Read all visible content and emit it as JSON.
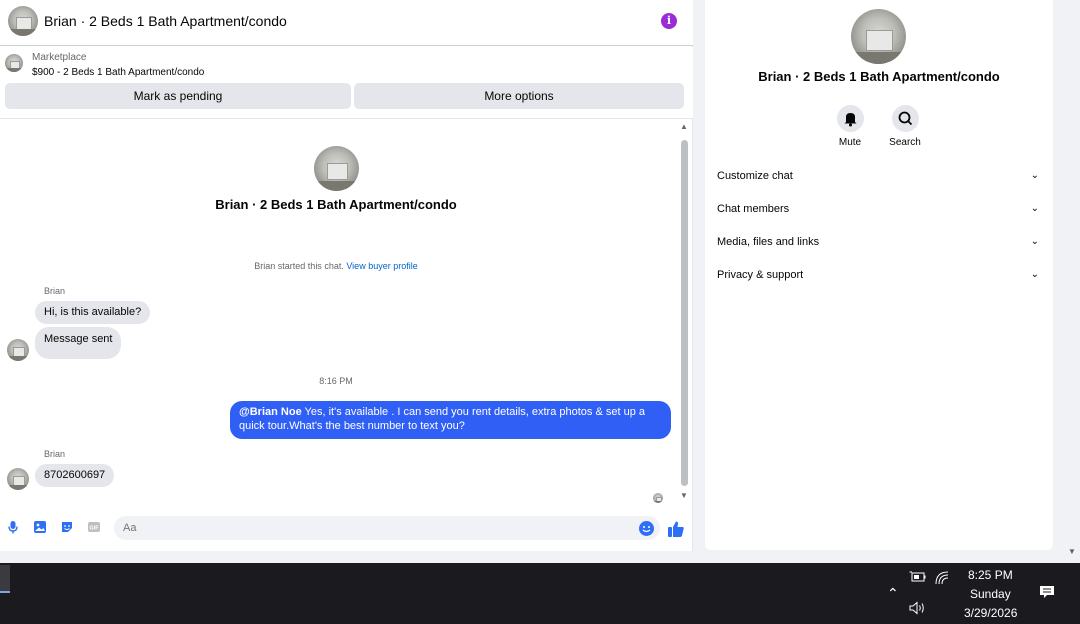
{
  "header": {
    "title": "Brian · 2 Beds 1 Bath Apartment/condo"
  },
  "marketplace": {
    "label": "Marketplace",
    "listing": "$900 - 2 Beds 1 Bath Apartment/condo",
    "pending_button": "Mark as pending",
    "more_button": "More options"
  },
  "conversation": {
    "title": "Brian · 2 Beds 1 Bath Apartment/condo",
    "started_text": "Brian started this chat.",
    "buyer_profile_link": "View buyer profile",
    "messages": [
      {
        "sender": "Brian",
        "text": "Hi, is this available?"
      },
      {
        "text": "Message sent"
      },
      {
        "time": "8:16 PM"
      },
      {
        "mention": "@Brian Noe",
        "text": " Yes, it's available .  I can send you rent details, extra photos & set up a quick tour.What's the best number to text you?"
      },
      {
        "sender": "Brian",
        "text": "8702600697"
      }
    ]
  },
  "composer": {
    "placeholder": "Aa",
    "icons": [
      "microphone-icon",
      "image-icon",
      "sticker-icon",
      "gif-icon",
      "emoji-icon",
      "like-icon"
    ]
  },
  "right_panel": {
    "title": "Brian · 2 Beds 1 Bath Apartment/condo",
    "actions": [
      {
        "label": "Mute",
        "icon": "bell-icon"
      },
      {
        "label": "Search",
        "icon": "search-icon"
      }
    ],
    "sections": [
      {
        "label": "Customize chat"
      },
      {
        "label": "Chat members"
      },
      {
        "label": "Media, files and links"
      },
      {
        "label": "Privacy & support"
      }
    ]
  },
  "taskbar": {
    "time": "8:25 PM",
    "day": "Sunday",
    "date": "3/29/2026"
  },
  "colors": {
    "accent": "#2f5ff5",
    "info": "#9b2bd5",
    "link": "#0064d1"
  }
}
